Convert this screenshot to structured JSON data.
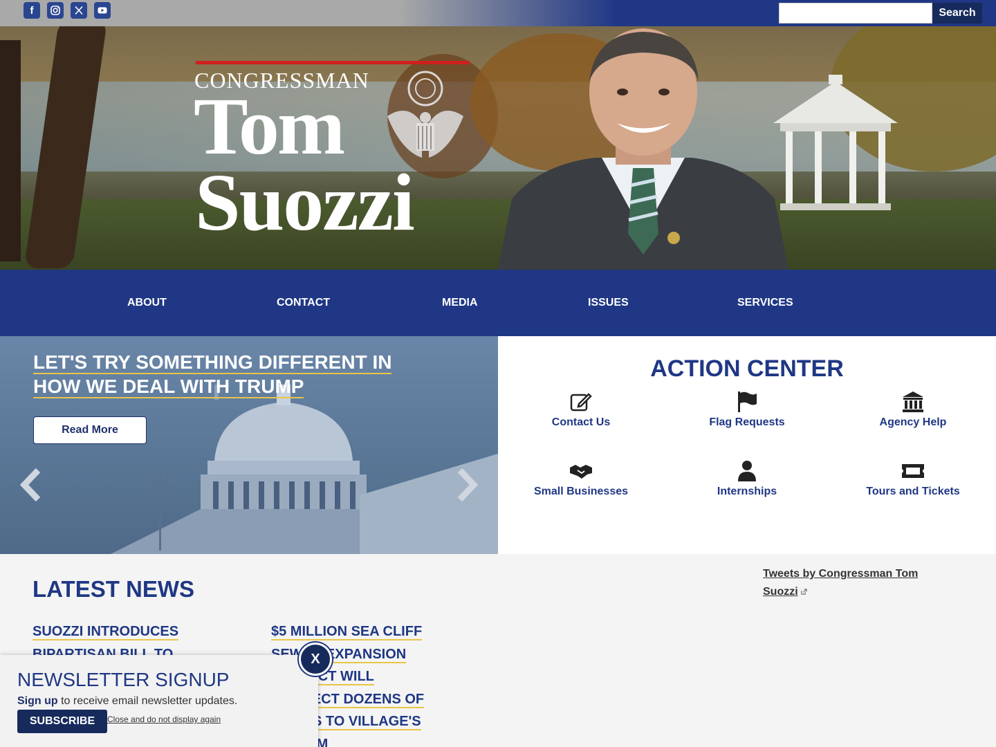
{
  "social": {
    "facebook": "f",
    "instagram": "instagram-icon",
    "x": "x-icon",
    "youtube": "youtube-icon"
  },
  "search": {
    "button": "Search",
    "placeholder": ""
  },
  "hero": {
    "congressman": "CONGRESSMAN",
    "first": "Tom",
    "last": "Suozzi"
  },
  "nav": [
    "ABOUT",
    "CONTACT",
    "MEDIA",
    "ISSUES",
    "SERVICES"
  ],
  "carousel": {
    "title_line1": "LET'S TRY SOMETHING DIFFERENT IN",
    "title_line2": "HOW WE DEAL WITH TRUMP",
    "button": "Read More"
  },
  "action_center": {
    "title": "ACTION CENTER",
    "items": [
      "Contact Us",
      "Flag Requests",
      "Agency Help",
      "Small Businesses",
      "Internships",
      "Tours and Tickets"
    ]
  },
  "news": {
    "title": "LATEST NEWS",
    "col1": [
      "SUOZZI INTRODUCES",
      "BIPARTISAN BILL TO"
    ],
    "col2": [
      "$5 MILLION SEA CLIFF",
      "SEWER EXPANSION",
      "PROJECT WILL",
      "CONNECT DOZENS OF",
      "HOMES TO VILLAGE'S",
      "SYSTEM"
    ]
  },
  "tweets": {
    "line1": "Tweets by Congressman Tom",
    "line2": "Suozzi"
  },
  "newsletter": {
    "title": "NEWSLETTER SIGNUP",
    "bold": "Sign up",
    "text": " to receive email newsletter updates.",
    "subscribe": "SUBSCRIBE",
    "dismiss": "Close and do not display again",
    "close": "X"
  },
  "colors": {
    "navy": "#1f3784",
    "dark_navy": "#162a5c",
    "accent_red": "#d0201e",
    "underline_gold": "#e8c548"
  }
}
